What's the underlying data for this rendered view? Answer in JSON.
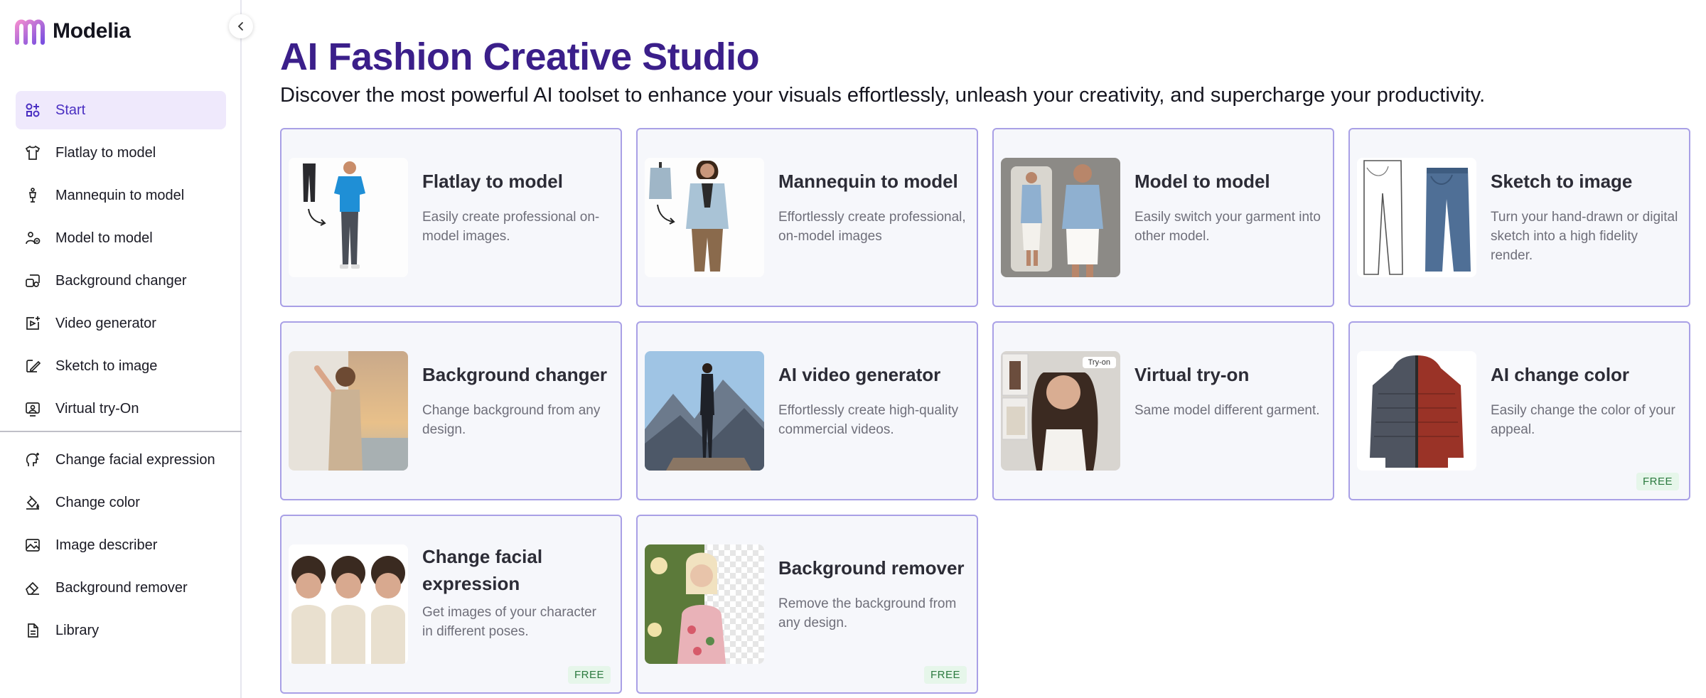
{
  "app": {
    "name": "Modelia"
  },
  "sidebar": {
    "items": [
      {
        "label": "Start",
        "icon": "apps-icon",
        "active": true
      },
      {
        "label": "Flatlay to model",
        "icon": "shirt-icon"
      },
      {
        "label": "Mannequin to model",
        "icon": "mannequin-icon"
      },
      {
        "label": "Model to model",
        "icon": "person-swap-icon"
      },
      {
        "label": "Background changer",
        "icon": "background-icon"
      },
      {
        "label": "Video generator",
        "icon": "video-plus-icon"
      },
      {
        "label": "Sketch to image",
        "icon": "sketch-icon"
      },
      {
        "label": "Virtual try-On",
        "icon": "try-on-icon"
      }
    ],
    "tools": [
      {
        "label": "Change facial expression",
        "icon": "face-icon"
      },
      {
        "label": "Change color",
        "icon": "paint-bucket-icon"
      },
      {
        "label": "Image describer",
        "icon": "image-text-icon"
      },
      {
        "label": "Background remover",
        "icon": "eraser-icon"
      },
      {
        "label": "Library",
        "icon": "document-icon"
      }
    ]
  },
  "main": {
    "title": "AI Fashion Creative Studio",
    "subtitle": "Discover the most powerful AI toolset to enhance your visuals effortlessly, unleash your creativity, and supercharge your productivity.",
    "cards": [
      {
        "title": "Flatlay to model",
        "desc": "Easily create professional on-model images.",
        "image": "flatlay-thumbnail"
      },
      {
        "title": "Mannequin to model",
        "desc": "Effortlessly create professional, on-model images",
        "image": "mannequin-thumbnail"
      },
      {
        "title": "Model to model",
        "desc": "Easily switch your garment into other model.",
        "image": "model-thumbnail"
      },
      {
        "title": "Sketch to image",
        "desc": "Turn your hand-drawn or digital sketch into a high fidelity render.",
        "image": "sketch-thumbnail"
      },
      {
        "title": "Background changer",
        "desc": "Change background from any design.",
        "image": "background-thumbnail"
      },
      {
        "title": "AI video generator",
        "desc": "Effortlessly create high-quality commercial videos.",
        "image": "video-thumbnail"
      },
      {
        "title": "Virtual try-on",
        "desc": "Same model different garment.",
        "image": "tryon-thumbnail",
        "image_label": "Try-on"
      },
      {
        "title": "AI change color",
        "desc": "Easily change the color of your appeal.",
        "image": "jacket-thumbnail",
        "badge": "FREE"
      },
      {
        "title": "Change facial expression",
        "desc": "Get images of your character in different poses.",
        "image": "faces-thumbnail",
        "badge": "FREE"
      },
      {
        "title": "Background remover",
        "desc": "Remove the background from any design.",
        "image": "remover-thumbnail",
        "badge": "FREE"
      }
    ]
  },
  "colors": {
    "accent": "#3b1f8a",
    "active_bg": "#efe9fc",
    "card_border": "#a9a0e6",
    "card_bg": "#f6f7fb",
    "badge_bg": "#e6f6ea",
    "badge_text": "#2b7a3f"
  }
}
